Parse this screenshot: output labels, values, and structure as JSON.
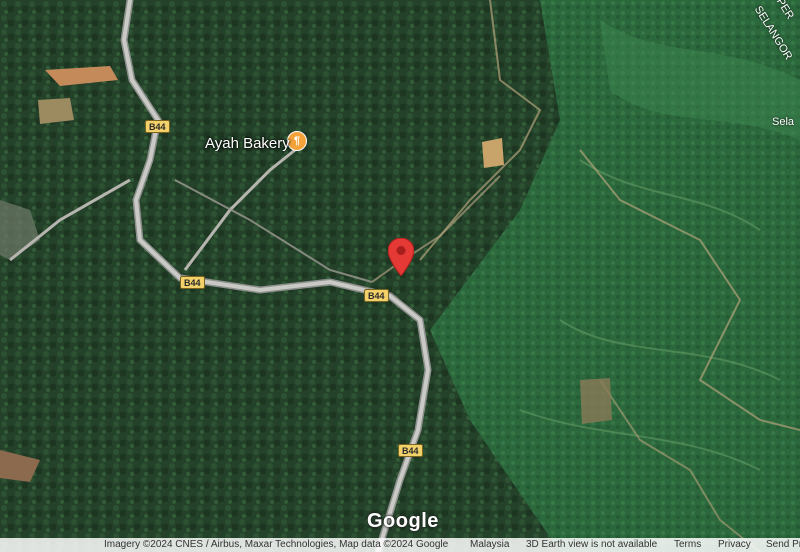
{
  "map": {
    "poi": {
      "name": "Ayah Bakery",
      "icon": "restaurant-icon",
      "color": "#f4a23a"
    },
    "road_shields": [
      "B44",
      "B44",
      "B44",
      "B44"
    ],
    "edge_labels": {
      "top_right_state": "SELANGOR",
      "top_right_partial": "PER",
      "right_partial": "Sela"
    },
    "marker": {
      "icon": "location-pin-icon",
      "color": "#e53935"
    },
    "branding": "Google"
  },
  "footer": {
    "attribution": "Imagery ©2024 CNES / Airbus, Maxar Technologies, Map data ©2024 Google",
    "region": "Malaysia",
    "earth_notice": "3D Earth view is not available",
    "terms": "Terms",
    "privacy": "Privacy",
    "feedback": "Send Product Feedback"
  }
}
